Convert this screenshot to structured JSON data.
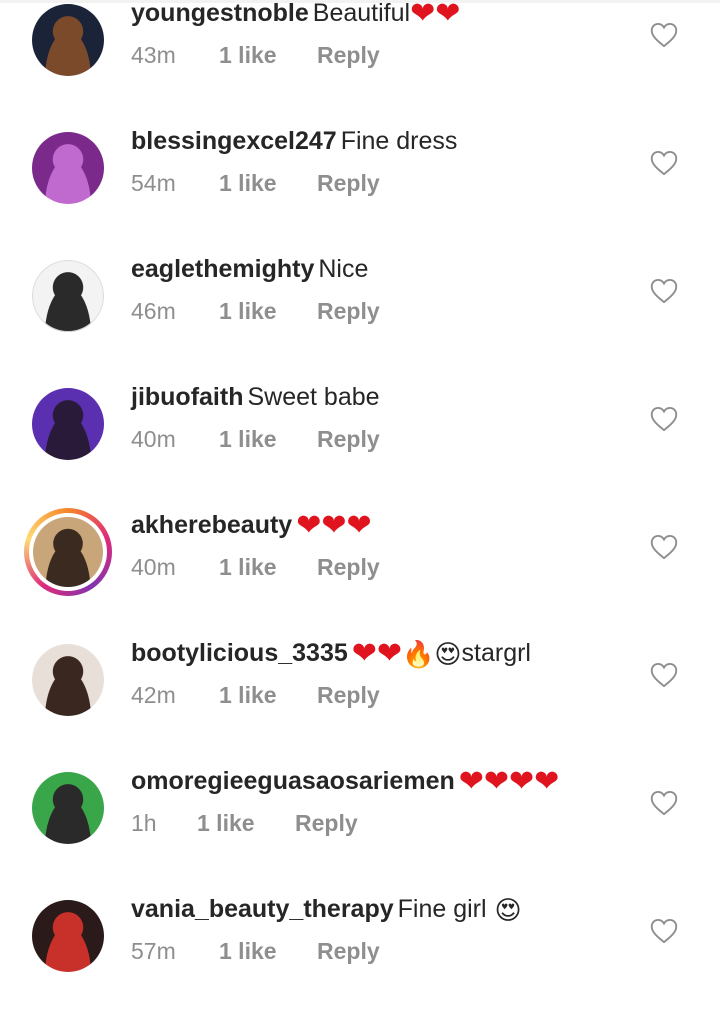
{
  "comments": [
    {
      "username": "youngestnoble",
      "text": "Beautiful",
      "hearts": 2,
      "emojis": [],
      "tail": "",
      "time": "43m",
      "likes": "1 like",
      "reply": "Reply",
      "avatar": {
        "bg": "#1a2338",
        "fg": "#7a4a2a",
        "ring": false
      }
    },
    {
      "username": "blessingexcel247",
      "text": "Fine dress",
      "hearts": 0,
      "emojis": [],
      "tail": "",
      "time": "54m",
      "likes": "1 like",
      "reply": "Reply",
      "avatar": {
        "bg": "#7b2a8c",
        "fg": "#c06ad0",
        "ring": false
      }
    },
    {
      "username": "eaglethemighty",
      "text": "Nice",
      "hearts": 0,
      "emojis": [],
      "tail": "",
      "time": "46m",
      "likes": "1 like",
      "reply": "Reply",
      "avatar": {
        "bg": "#f3f3f3",
        "fg": "#2a2a2a",
        "ring": false
      }
    },
    {
      "username": "jibuofaith",
      "text": "Sweet babe",
      "hearts": 0,
      "emojis": [],
      "tail": "",
      "time": "40m",
      "likes": "1 like",
      "reply": "Reply",
      "avatar": {
        "bg": "#5a2fb0",
        "fg": "#2a1a3a",
        "ring": false
      }
    },
    {
      "username": "akherebeauty",
      "text": "",
      "hearts": 3,
      "emojis": [],
      "tail": "",
      "time": "40m",
      "likes": "1 like",
      "reply": "Reply",
      "avatar": {
        "bg": "#c9a57a",
        "fg": "#3a2a20",
        "ring": true
      }
    },
    {
      "username": "bootylicious_3335",
      "text": "",
      "hearts": 2,
      "emojis": [
        "🔥",
        "😍"
      ],
      "tail": "stargrl",
      "time": "42m",
      "likes": "1 like",
      "reply": "Reply",
      "avatar": {
        "bg": "#e8e0d8",
        "fg": "#3a2820",
        "ring": false
      }
    },
    {
      "username": "omoregieeguasaosariemen",
      "text": "",
      "hearts": 4,
      "emojis": [],
      "tail": "",
      "time": "1h",
      "likes": "1 like",
      "reply": "Reply",
      "avatar": {
        "bg": "#3aa64a",
        "fg": "#2a2a2a",
        "ring": false
      }
    },
    {
      "username": "vania_beauty_therapy",
      "text": "Fine girl",
      "hearts": 0,
      "emojis": [
        "😍"
      ],
      "tail": "",
      "time": "57m",
      "likes": "1 like",
      "reply": "Reply",
      "avatar": {
        "bg": "#2a1a1a",
        "fg": "#c8302a",
        "ring": false
      }
    }
  ],
  "icons": {
    "heart_glyph": "❤",
    "like_icon": "heart-outline-icon"
  },
  "colors": {
    "heart": "#e0141e",
    "meta": "#8e8e8e",
    "text": "#262626"
  }
}
